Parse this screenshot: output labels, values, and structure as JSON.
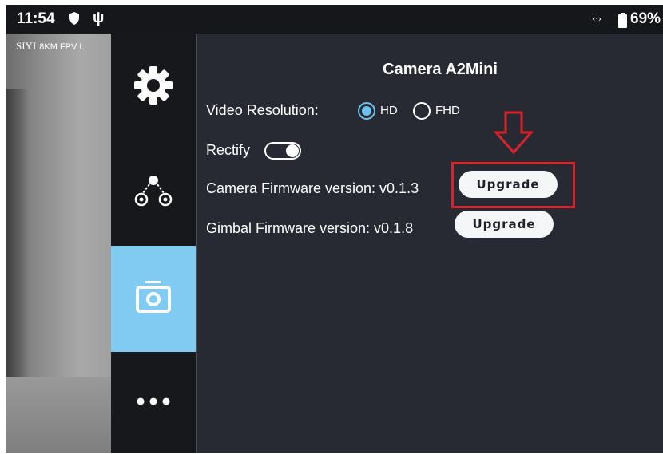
{
  "status_bar": {
    "time": "11:54",
    "battery": "69%",
    "link_symbol": "‹·›",
    "usb_symbol": "ψ",
    "icons": [
      "shield-icon",
      "usb-icon",
      "data-link-icon",
      "battery-icon"
    ]
  },
  "camera_preview": {
    "brand": "SIYI",
    "model_text": "8KM FPV L"
  },
  "sidebar": {
    "items": [
      {
        "name": "settings",
        "icon": "gear-icon",
        "active": false
      },
      {
        "name": "gimbal",
        "icon": "gimbal-icon",
        "active": false
      },
      {
        "name": "camera",
        "icon": "camera-icon",
        "active": true
      },
      {
        "name": "more",
        "icon": "more-icon",
        "active": false
      }
    ]
  },
  "panel": {
    "title": "Camera A2Mini",
    "video_resolution": {
      "label": "Video Resolution:",
      "options": [
        "HD",
        "FHD"
      ],
      "selected": "HD"
    },
    "rectify": {
      "label": "Rectify",
      "enabled": false
    },
    "camera_firmware": {
      "label": "Camera Firmware version: v0.1.3",
      "button": "Upgrade"
    },
    "gimbal_firmware": {
      "label": "Gimbal Firmware version: v0.1.8",
      "button": "Upgrade"
    }
  },
  "annotation": {
    "color": "#d8232a",
    "arrow_icon": "down-arrow-icon"
  },
  "colors": {
    "accent": "#80cbf2",
    "radio_selected": "#6ec3ee",
    "background": "#272a33",
    "sidebar": "#16181c"
  }
}
